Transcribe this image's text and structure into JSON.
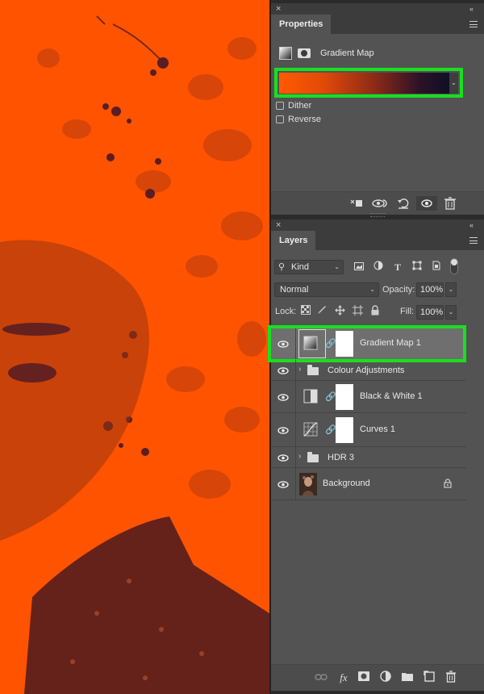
{
  "canvas": {
    "background_color": "#ff5300",
    "shadow_color": "#5a1e22"
  },
  "properties": {
    "close": "×",
    "collapse": "‹‹",
    "tab_label": "Properties",
    "title": "Gradient Map",
    "gradient": {
      "from": "#ff5a00",
      "to": "#0c0e26",
      "highlight": "#18e01e"
    },
    "dither_label": "Dither",
    "dither_checked": false,
    "reverse_label": "Reverse",
    "reverse_checked": false,
    "bottom_icons": [
      "clip-to-layer-icon",
      "view-previous-state-icon",
      "reset-icon",
      "visibility-eye-icon",
      "delete-icon"
    ]
  },
  "layers_panel": {
    "close": "×",
    "collapse": "‹‹",
    "tab_label": "Layers",
    "filter": {
      "kind_label": "Kind"
    },
    "blend_mode": "Normal",
    "opacity_label": "Opacity:",
    "opacity_value": "100%",
    "lock_label": "Lock:",
    "fill_label": "Fill:",
    "fill_value": "100%",
    "layers": [
      {
        "name": "Gradient Map 1",
        "type": "adjustment",
        "selected": true,
        "visible": true
      },
      {
        "name": "Colour Adjustments",
        "type": "group",
        "visible": true
      },
      {
        "name": "Black & White 1",
        "type": "adjustment",
        "visible": true
      },
      {
        "name": "Curves 1",
        "type": "adjustment",
        "visible": true
      },
      {
        "name": "HDR 3",
        "type": "group",
        "visible": true
      },
      {
        "name": "Background",
        "type": "image",
        "locked": true,
        "visible": true
      }
    ],
    "bottom_icons": [
      "link-layers-icon",
      "fx-icon",
      "add-mask-icon",
      "adjustment-layer-icon",
      "new-group-icon",
      "new-layer-icon",
      "delete-layer-icon"
    ],
    "fx_label": "fx"
  }
}
